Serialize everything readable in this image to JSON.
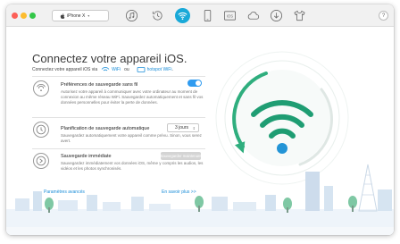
{
  "window": {
    "device_selector": "iPhone X"
  },
  "toolbar": {
    "icons": [
      "music-icon",
      "history-icon",
      "wifi-icon",
      "phone-icon",
      "ios-update-icon",
      "cloud-icon",
      "download-icon",
      "tshirt-icon"
    ],
    "help_label": "?"
  },
  "main": {
    "title": "Connectez votre appareil iOS.",
    "connect_prefix": "Connectez votre appareil iOS via",
    "connect_wifi": "WiFi",
    "connect_or": "ou",
    "connect_hotspot": "hotspot WiFi",
    "connect_suffix": "."
  },
  "rows": [
    {
      "title": "Préférences de sauvegarde sans fil",
      "desc": "Autorisez votre appareil à communiquer avec votre ordinateur au moment de connexion au même réseau WiFi. Sauvegardez automatiquement et sans fil vos données personnelles pour éviter la perte de données.",
      "toggle_on": true
    },
    {
      "title": "Planification de sauvegarde automatique",
      "desc": "Sauvegardez automatiquement votre appareil comme prévu. Sinon, vous serez avert.",
      "select_value": "3 jours"
    },
    {
      "title": "Sauvegarde immédiate",
      "desc": "Sauvegardez immédiatement vos données iOS, même y compris les audios, les vidéos et les photos synchronisés.",
      "button_label": "Sauvegarder maintenant"
    }
  ],
  "footer": {
    "advanced_link": "Paramètres avancés",
    "learn_more_link": "En savoir plus >>"
  },
  "colors": {
    "accent": "#19a9d8",
    "wifi_green": "#1f9d73",
    "toggle_blue": "#2f9bf0"
  }
}
